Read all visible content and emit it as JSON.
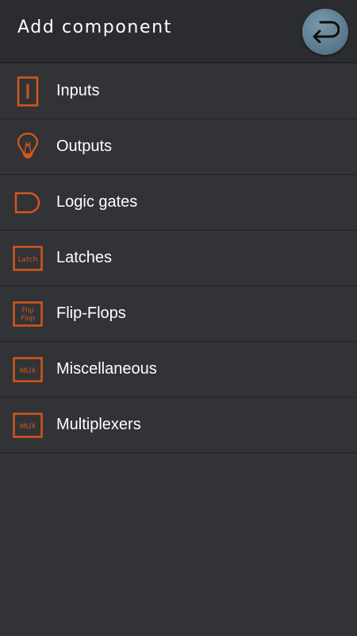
{
  "header": {
    "title": "Add component",
    "back_icon": "undo-arrow-icon"
  },
  "colors": {
    "accent": "#d4561c",
    "background": "#323336",
    "header": "#2b2c2f",
    "back_button": "#6a889c",
    "text": "#ffffff"
  },
  "items": [
    {
      "label": "Inputs",
      "icon": "input-switch-icon"
    },
    {
      "label": "Outputs",
      "icon": "lightbulb-icon"
    },
    {
      "label": "Logic gates",
      "icon": "and-gate-icon"
    },
    {
      "label": "Latches",
      "icon": "latch-icon",
      "icon_text": "Latch"
    },
    {
      "label": "Flip-Flops",
      "icon": "flip-flop-icon",
      "icon_text_1": "Flip",
      "icon_text_2": "Flop"
    },
    {
      "label": "Miscellaneous",
      "icon": "mux-icon",
      "icon_text": "MUX"
    },
    {
      "label": "Multiplexers",
      "icon": "mux-icon",
      "icon_text": "MUX"
    }
  ]
}
